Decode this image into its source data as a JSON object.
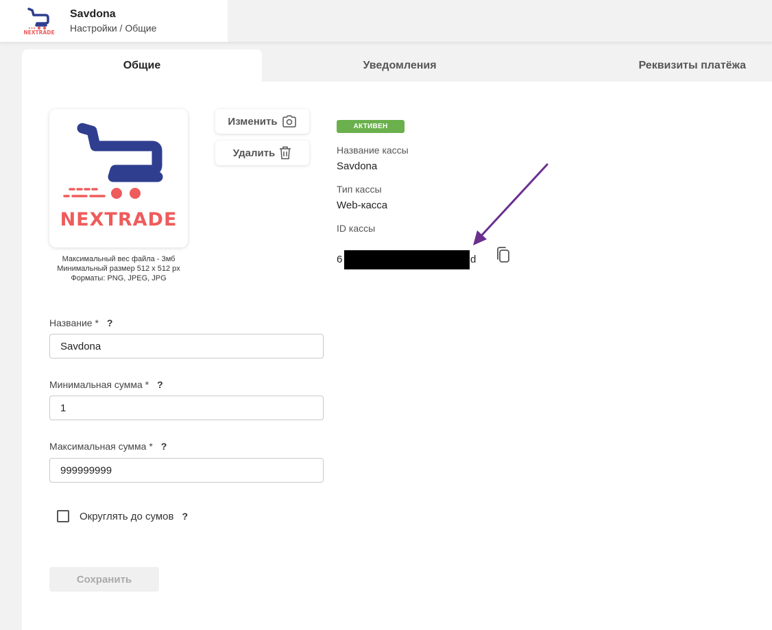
{
  "header": {
    "title": "Savdona",
    "breadcrumb": "Настройки / Общие",
    "logo_icon": "nextrade-logo"
  },
  "tabs": [
    {
      "label": "Общие",
      "active": true
    },
    {
      "label": "Уведомления",
      "active": false
    },
    {
      "label": "Реквизиты платёжа",
      "active": false
    }
  ],
  "logo": {
    "brand_text": "NEXTRADE",
    "hints": [
      "Максимальный вес файла - 3мб",
      "Минимальный размер 512 x 512 px",
      "Форматы: PNG, JPEG, JPG"
    ]
  },
  "buttons": {
    "change_label": "Изменить",
    "change_icon": "camera-icon",
    "delete_label": "Удалить",
    "delete_icon": "trash-icon",
    "save_label": "Сохранить"
  },
  "info": {
    "status": "АКТИВЕН",
    "status_color": "#6ab04c",
    "name_label": "Название кассы",
    "name_value": "Savdona",
    "type_label": "Тип кассы",
    "type_value": "Web-касса",
    "id_label": "ID кассы",
    "id_visible_start": "6",
    "id_visible_end": "d"
  },
  "form": {
    "name": {
      "label": "Название *",
      "help": "?",
      "value": "Savdona"
    },
    "min_sum": {
      "label": "Минимальная сумма *",
      "help": "?",
      "value": "1"
    },
    "max_sum": {
      "label": "Максимальная сумма *",
      "help": "?",
      "value": "999999999"
    },
    "round": {
      "label": "Округлять до сумов",
      "help": "?",
      "checked": false
    }
  },
  "colors": {
    "brand_blue": "#2f3e8f",
    "brand_red": "#ee5c5c",
    "annotation_arrow": "#6a2f8f"
  }
}
